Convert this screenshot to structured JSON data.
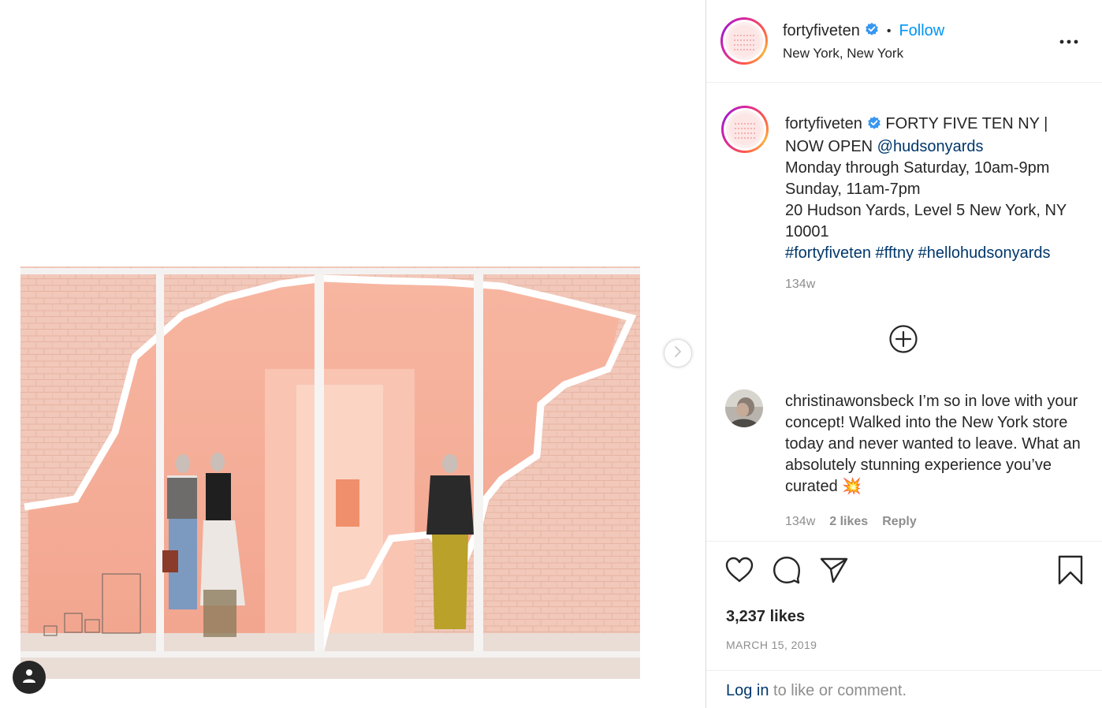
{
  "account": {
    "username": "fortyfiveten",
    "location": "New York, New York",
    "follow_label": "Follow",
    "separator": "•",
    "verified": true
  },
  "caption": {
    "username": "fortyfiveten",
    "line1": "FORTY FIVE TEN NY | NOW OPEN ",
    "mention": "@hudsonyards",
    "line2": "Monday through Saturday, 10am-9pm",
    "line3": "Sunday, 11am-7pm",
    "line4": "20 Hudson Yards, Level 5 New York, NY 10001",
    "hashtags": [
      "#fortyfiveten",
      "#fftny",
      "#hellohudsonyards"
    ],
    "time": "134w"
  },
  "comment": {
    "username": "christinawonsbeck",
    "text": "I’m so in love with your concept! Walked into the New York store today and never wanted to leave. What an absolutely stunning experience you’ve curated",
    "emoji": "💥",
    "time": "134w",
    "likes": "2 likes",
    "reply_label": "Reply"
  },
  "post": {
    "likes": "3,237 likes",
    "date": "MARCH 15, 2019"
  },
  "login": {
    "link_label": "Log in",
    "rest": " to like or comment."
  },
  "icons": {
    "more": "more-options-icon",
    "load_more": "plus-circle-icon",
    "like": "heart-icon",
    "comment": "comment-bubble-icon",
    "share": "paper-plane-icon",
    "save": "bookmark-icon",
    "next": "chevron-right-icon",
    "user": "person-icon"
  },
  "colors": {
    "accent": "#0095f6",
    "link": "#00376b",
    "muted": "#8e8e8e",
    "text": "#262626",
    "photo_pink": "#f4b2a2"
  }
}
